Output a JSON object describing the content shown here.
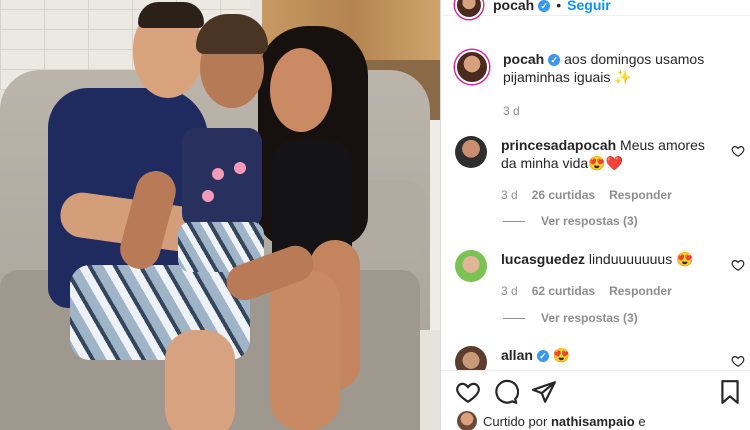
{
  "post": {
    "author": "pocah",
    "follow_label": "Seguir",
    "separator": "•"
  },
  "caption": {
    "author": "pocah",
    "text": "aos domingos usamos pijaminhas iguais",
    "emoji": "✨",
    "time": "3 d"
  },
  "comments": [
    {
      "user": "princesadapocah",
      "text": "Meus amores da minha vida",
      "emoji": "😍❤️",
      "time": "3 d",
      "likes": "26 curtidas",
      "reply_label": "Responder",
      "view_replies": "Ver respostas (3)",
      "avatar_color": "#3b3b3b"
    },
    {
      "user": "lucasguedez",
      "text": "linduuuuuuus",
      "emoji": "😍",
      "time": "3 d",
      "likes": "62 curtidas",
      "reply_label": "Responder",
      "view_replies": "Ver respostas (3)",
      "avatar_color": "#6fbf4a"
    },
    {
      "user": "allan",
      "text": "",
      "emoji": "😍",
      "avatar_color": "#b88a6a"
    }
  ],
  "liked_by": {
    "prefix": "Curtido por",
    "user": "nathisampaio",
    "suffix": "e"
  },
  "icons": {
    "like": "heart-outline-icon",
    "comment": "comment-bubble-icon",
    "share": "paper-plane-icon",
    "save": "bookmark-icon",
    "verified": "verified-badge-icon"
  },
  "colors": {
    "link": "#0095f6",
    "muted": "#8e8e8e",
    "verified": "#3897f0",
    "text": "#262626"
  }
}
